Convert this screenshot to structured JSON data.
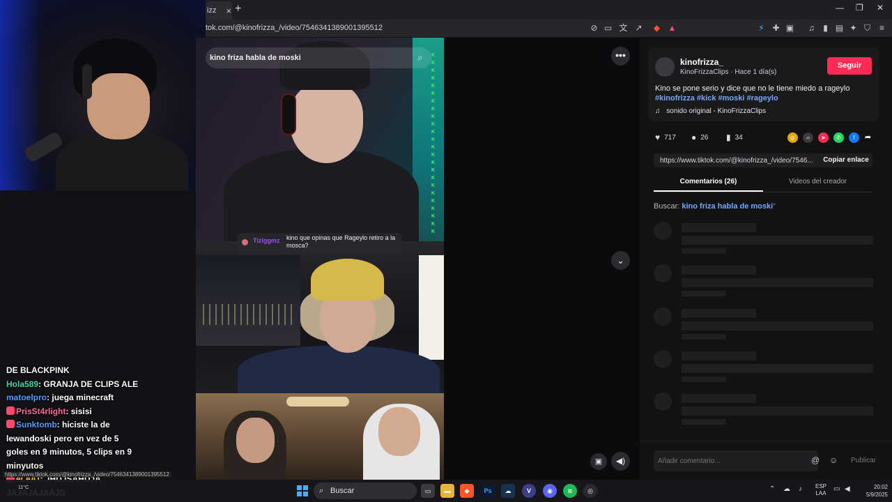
{
  "browser": {
    "tab_label": "izz",
    "tab_close": "×",
    "new_tab": "+",
    "url": "tok.com/@kinofrizza_/video/7546341389001395512",
    "minimize": "—",
    "restore": "❐",
    "close": "✕"
  },
  "video": {
    "search_text": "kino friza habla de moski",
    "chat_user": "Tiziggmz",
    "chat_message": "kino que opinas que Rageylo retiro a la mosca?",
    "k_marks": "K K K K K K K K K K K K K K K K K K K K K K K K"
  },
  "post": {
    "author": "kinofrizza_",
    "author_sub": "KinoFrizzaClips · Hace 1 día(s)",
    "follow_label": "Seguir",
    "description": "Kino se pone serio y dice que no le tiene miedo a rageylo",
    "hashtags": "#kinofrizza #kick #moski #rageylo",
    "sound": "sonido original - KinoFrizzaClips",
    "likes": "717",
    "comments": "26",
    "saves": "34",
    "link": "https://www.tiktok.com/@kinofrizza_/video/7546...",
    "copy_label": "Copiar enlace",
    "tab_comments": "Comentarios (26)",
    "tab_creator": "Videos del creador",
    "search_prefix": "Buscar:",
    "search_query": "kino friza habla de moski",
    "comment_placeholder": "Añadir comentario...",
    "publish_label": "Publicar"
  },
  "chat": [
    {
      "user": "",
      "text": "DE BLACKPINK",
      "color": "none"
    },
    {
      "user": "Hola589",
      "text": "GRANJA DE CLIPS ALE",
      "color": "green"
    },
    {
      "user": "matoelpro",
      "text": "juega minecraft",
      "color": "blue"
    },
    {
      "user": "PrisSt4rlight",
      "text": "sisisi",
      "color": "pink"
    },
    {
      "user": "Sunktomb",
      "text": "hiciste la de",
      "color": "blue"
    },
    {
      "user": "",
      "text": "lewandoski pero en vez de 5",
      "color": "none"
    },
    {
      "user": "",
      "text": "goles en 9 minutos, 5 clips en 9",
      "color": "none"
    },
    {
      "user": "",
      "text": "minyutos",
      "color": "none"
    },
    {
      "user": "eLeAT",
      "text": "JHDJSAHDJA",
      "color": "yellow"
    },
    {
      "user": "",
      "text": "JAJAJAJAAJS",
      "color": "none"
    }
  ],
  "status_url": "https://www.tiktok.com/@kinofrizza_/video/7546341389001395512",
  "taskbar": {
    "weather_temp": "11°C",
    "search_label": "Buscar",
    "lang_1": "ESP",
    "lang_2": "LAA",
    "time": "20:02",
    "date": "5/9/2025"
  },
  "colors": {
    "accent": "#fe2c55",
    "hashtag": "#72a8ff"
  }
}
